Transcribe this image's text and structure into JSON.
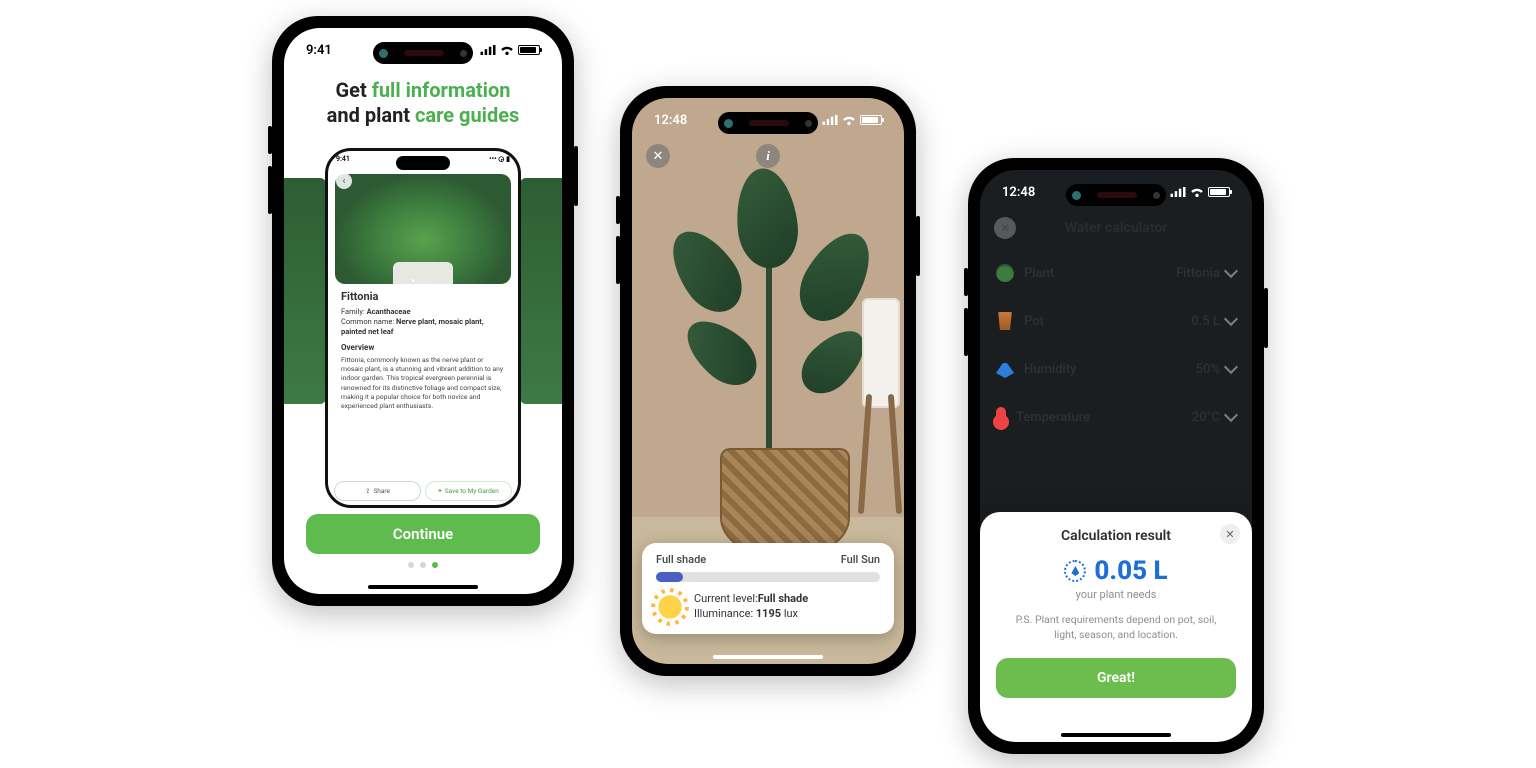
{
  "phone1": {
    "status_time": "9:41",
    "headline_pre": "Get ",
    "headline_em1": "full information",
    "headline_mid": " and plant ",
    "headline_em2": "care guides",
    "mini": {
      "status_time": "9:41",
      "title": "Fittonia",
      "family_label": "Family: ",
      "family_value": "Acanthaceae",
      "common_label": "Common name: ",
      "common_value": "Nerve plant, mosaic plant, painted net leaf",
      "overview_label": "Overview",
      "overview_text": "Fittonia, commonly known as the nerve plant or mosaic plant, is a stunning and vibrant addition to any indoor garden. This tropical evergreen perennial is renowned for its distinctive foliage and compact size, making it a popular choice for both novice and experienced plant enthusiasts.",
      "share_label": "Share",
      "save_label": "Save to My Garden"
    },
    "continue_label": "Continue",
    "pager_index": 3,
    "pager_total": 3
  },
  "phone2": {
    "status_time": "12:48",
    "labels": {
      "left": "Full shade",
      "right": "Full Sun"
    },
    "bar_fill_pct": 12,
    "current_label": "Current level:",
    "current_value": "Full shade",
    "illum_label": "Illuminance: ",
    "illum_value": "1195",
    "illum_unit": " lux"
  },
  "phone3": {
    "status_time": "12:48",
    "title": "Water calculator",
    "rows": {
      "plant": {
        "label": "Plant",
        "value": "Fittonia"
      },
      "pot": {
        "label": "Pot",
        "value": "0.5 L"
      },
      "humidity": {
        "label": "Humidity",
        "value": "50%"
      },
      "temperature": {
        "label": "Temperature",
        "value": "20°C"
      }
    },
    "sheet": {
      "title": "Calculation result",
      "amount": "0.05 L",
      "subtitle": "your plant needs",
      "ps": "P.S. Plant requirements depend on pot, soil, light, season, and location.",
      "cta": "Great!"
    }
  }
}
